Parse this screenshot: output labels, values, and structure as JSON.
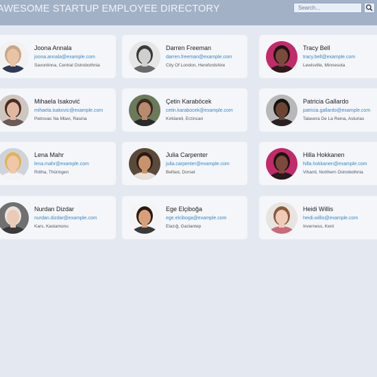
{
  "header": {
    "title": "AWESOME STARTUP EMPLOYEE DIRECTORY",
    "search_placeholder": "Search...",
    "search_icon": "magnifier-icon"
  },
  "employees": [
    {
      "name": "Joona Annala",
      "email": "joona.annala@example.com",
      "location": "Savonlinna, Central Ostrobothnia",
      "skin": "#e9c3a6",
      "hair": "#c8a688",
      "bg": "#f2f2f2",
      "shirt": "#2f3a55"
    },
    {
      "name": "Darren Freeman",
      "email": "darren.freeman@example.com",
      "location": "City Of London, Herefordshire",
      "skin": "#cfcfcf",
      "hair": "#3a3a3a",
      "bg": "#e6e6e6",
      "shirt": "#6a6a6a"
    },
    {
      "name": "Tracy Bell",
      "email": "tracy.bell@example.com",
      "location": "Lewisville, Minnesota",
      "skin": "#7a4a3a",
      "hair": "#1e1410",
      "bg": "#c22a6a",
      "shirt": "#2a1a1a"
    },
    {
      "name": "Mihaela Isaković",
      "email": "mihaela.isakovic@example.com",
      "location": "Petrovac Na Mlavi, Rasina",
      "skin": "#e2b7a0",
      "hair": "#4a2d22",
      "bg": "#cfc6c0",
      "shirt": "#6b5a55"
    },
    {
      "name": "Çetin Karaböcek",
      "email": "cetin.karabocek@example.com",
      "location": "Kırklareli, Erzincan",
      "skin": "#b98a6e",
      "hair": "#3d2a20",
      "bg": "#6a7a5a",
      "shirt": "#2a2a2a"
    },
    {
      "name": "Patricia Gallardo",
      "email": "patricia.gallardo@example.com",
      "location": "Talavera De La Reina, Asturias",
      "skin": "#6b4434",
      "hair": "#181212",
      "bg": "#b8b8b8",
      "shirt": "#2a2020"
    },
    {
      "name": "Lena Mahr",
      "email": "lena.mahr@example.com",
      "location": "Rötha, Thüringen",
      "skin": "#f0c8a8",
      "hair": "#e3b25a",
      "bg": "#d0d4da",
      "shirt": "#f4f4f4"
    },
    {
      "name": "Julia Carpenter",
      "email": "julia.carpenter@example.com",
      "location": "Belfast, Dorset",
      "skin": "#c8926c",
      "hair": "#2a1a12",
      "bg": "#5a4a3a",
      "shirt": "#e8e0d8"
    },
    {
      "name": "Hilla Hokkanen",
      "email": "hilla.hokkanen@example.com",
      "location": "Vihanti, Northern Ostrobothnia",
      "skin": "#7a4a3a",
      "hair": "#1e1410",
      "bg": "#c22a6a",
      "shirt": "#2a1a1a"
    },
    {
      "name": "Nurdan Dizdar",
      "email": "nurdan.dizdar@example.com",
      "location": "Kars, Kastamonu",
      "skin": "#eccab8",
      "hair": "#e8e2da",
      "bg": "#707070",
      "shirt": "#3a3a3a"
    },
    {
      "name": "Ege Elçiboğa",
      "email": "ege.elciboga@example.com",
      "location": "Elazığ, Gaziantep",
      "skin": "#d8a07a",
      "hair": "#2a1a12",
      "bg": "#f4f4f4",
      "shirt": "#3a3a3a"
    },
    {
      "name": "Heidi Willis",
      "email": "heidi.willis@example.com",
      "location": "Inverness, Kent",
      "skin": "#f0ccb6",
      "hair": "#8a5a3a",
      "bg": "#e8e4e0",
      "shirt": "#c86a7a"
    }
  ]
}
